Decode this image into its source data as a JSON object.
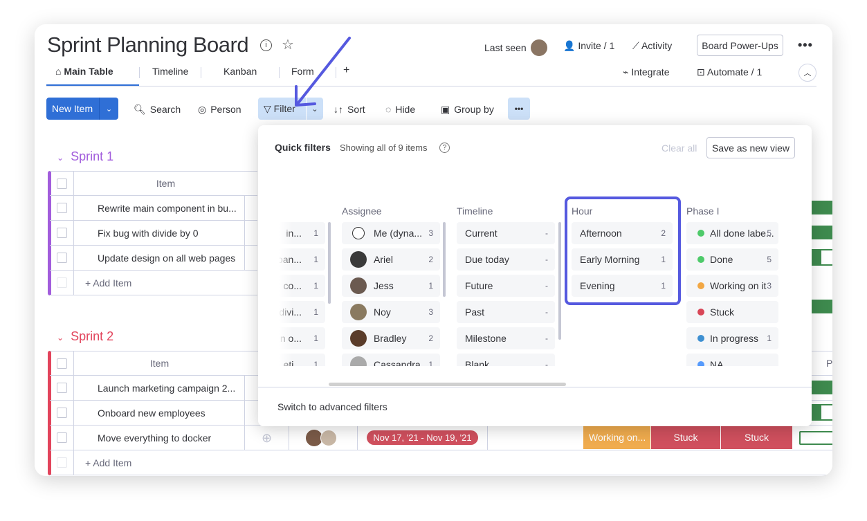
{
  "header": {
    "title": "Sprint Planning Board",
    "last_seen": "Last seen",
    "invite": "Invite / 1",
    "activity": "Activity",
    "power_ups": "Board Power-Ups",
    "integrate": "Integrate",
    "automate": "Automate / 1"
  },
  "tabs": [
    {
      "label": "Main Table"
    },
    {
      "label": "Timeline"
    },
    {
      "label": "Kanban"
    },
    {
      "label": "Form"
    },
    {
      "label": "+"
    }
  ],
  "toolbar": {
    "new_item": "New Item",
    "search": "Search",
    "person": "Person",
    "filter": "Filter",
    "sort": "Sort",
    "hide": "Hide",
    "group_by": "Group by"
  },
  "groups": [
    {
      "title": "Sprint 1",
      "color": "#a25ddc",
      "header": "Item",
      "items": [
        "Rewrite main component in bu...",
        "Fix bug with divide by 0",
        "Update design on all web pages"
      ],
      "add": "+ Add Item"
    },
    {
      "title": "Sprint 2",
      "color": "#e2445c",
      "header": "Item",
      "items": [
        "Launch marketing campaign 2...",
        "Onboard new employees",
        "Move everything to docker"
      ],
      "add": "+ Add Item",
      "timeline": "Nov 17, '21 - Nov 19, '21",
      "statuses": [
        "Working on...",
        "Stuck",
        "Stuck"
      ]
    }
  ],
  "popup": {
    "title": "Quick filters",
    "subtitle": "Showing all of 9 items",
    "clear_all": "Clear all",
    "save_view": "Save as new view",
    "advanced": "Switch to advanced filters",
    "partial": [
      {
        "label": "in...",
        "count": "1"
      },
      {
        "label": "oan...",
        "count": "1"
      },
      {
        "label": "co...",
        "count": "1"
      },
      {
        "label": "divi...",
        "count": "1"
      },
      {
        "label": "n o...",
        "count": "1"
      },
      {
        "label": "eti...",
        "count": "1"
      }
    ],
    "assignee": {
      "title": "Assignee",
      "items": [
        {
          "label": "Me (dyna...",
          "count": "3"
        },
        {
          "label": "Ariel",
          "count": "2"
        },
        {
          "label": "Jess",
          "count": "1"
        },
        {
          "label": "Noy",
          "count": "3"
        },
        {
          "label": "Bradley",
          "count": "2"
        },
        {
          "label": "Cassandra",
          "count": "1"
        }
      ]
    },
    "timeline": {
      "title": "Timeline",
      "items": [
        {
          "label": "Current",
          "count": "-"
        },
        {
          "label": "Due today",
          "count": "-"
        },
        {
          "label": "Future",
          "count": "-"
        },
        {
          "label": "Past",
          "count": "-"
        },
        {
          "label": "Milestone",
          "count": "-"
        },
        {
          "label": "Blank",
          "count": "-"
        }
      ]
    },
    "hour": {
      "title": "Hour",
      "items": [
        {
          "label": "Afternoon",
          "count": "2"
        },
        {
          "label": "Early Morning",
          "count": "1"
        },
        {
          "label": "Evening",
          "count": "1"
        }
      ]
    },
    "phase": {
      "title": "Phase I",
      "items": [
        {
          "label": "All done labe...",
          "count": "5",
          "color": "#4eca6a"
        },
        {
          "label": "Done",
          "count": "5",
          "color": "#4eca6a"
        },
        {
          "label": "Working on it",
          "count": "3",
          "color": "#f2a744"
        },
        {
          "label": "Stuck",
          "count": "",
          "color": "#d84657"
        },
        {
          "label": "In progress",
          "count": "1",
          "color": "#3d8fd1"
        },
        {
          "label": "NA",
          "count": "",
          "color": "#579bfc"
        }
      ]
    }
  },
  "right_col_header": "P",
  "colors": {
    "accent": "#2f6fd6",
    "highlight": "#5559df",
    "green": "#3e8a4e",
    "stuck": "#d0505e",
    "working": "#f0ac4e"
  }
}
